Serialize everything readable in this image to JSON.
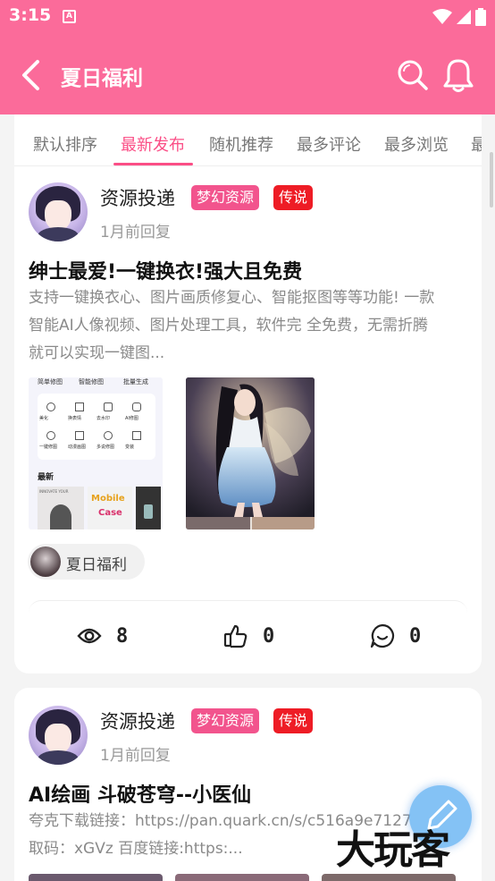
{
  "status_bar": {
    "time": "3:15",
    "sim_label": "A"
  },
  "app_bar": {
    "title": "夏日福利"
  },
  "tabs": [
    {
      "label": "默认排序"
    },
    {
      "label": "最新发布",
      "active": true
    },
    {
      "label": "随机推荐"
    },
    {
      "label": "最多评论"
    },
    {
      "label": "最多浏览"
    },
    {
      "label": "最"
    }
  ],
  "posts": [
    {
      "author": "资源投递",
      "badges": [
        "梦幻资源",
        "传说"
      ],
      "time": "1月前回复",
      "title": "绅士最爱!一键换衣!强大且免费",
      "body_lines": [
        "支持一键换衣心、图片画质修复心、智能抠图等等功能! 一款",
        "智能AI人像视频、图片处理工具，软件完 全免费，无需折腾",
        "就可以实现一键图..."
      ],
      "thumb1": {
        "top_labels": [
          "简单修图",
          "智能修图",
          "批量生成"
        ],
        "icon_labels": [
          "美化",
          "换表情",
          "去水印",
          "AI修图",
          "一键修图",
          "动漫画图",
          "多说修图",
          "变装"
        ],
        "section_label": "最新",
        "banner_text": "INNOVATE YOUR",
        "mobile_text": "Mobile",
        "case_text": "Case"
      },
      "tag": "夏日福利",
      "stats": {
        "views": "8",
        "likes": "0",
        "comments": "0"
      }
    },
    {
      "author": "资源投递",
      "badges": [
        "梦幻资源",
        "传说"
      ],
      "time": "1月前回复",
      "title": "AI绘画 斗破苍穹--小医仙",
      "body_lines": [
        "夸克下载链接：https://pan.quark.cn/s/c516a9e7127",
        "取码：xGVz 百度链接:https:..."
      ]
    }
  ],
  "watermark": "大玩客",
  "colors": {
    "brand_pink": "#fb6b9a",
    "active_tab": "#fb4e86",
    "badge_pink": "#f2548d",
    "badge_red": "#ee1c25"
  },
  "icons": [
    "back-arrow-icon",
    "search-icon",
    "bell-icon",
    "eye-icon",
    "thumbs-up-icon",
    "comment-icon",
    "edit-icon"
  ]
}
